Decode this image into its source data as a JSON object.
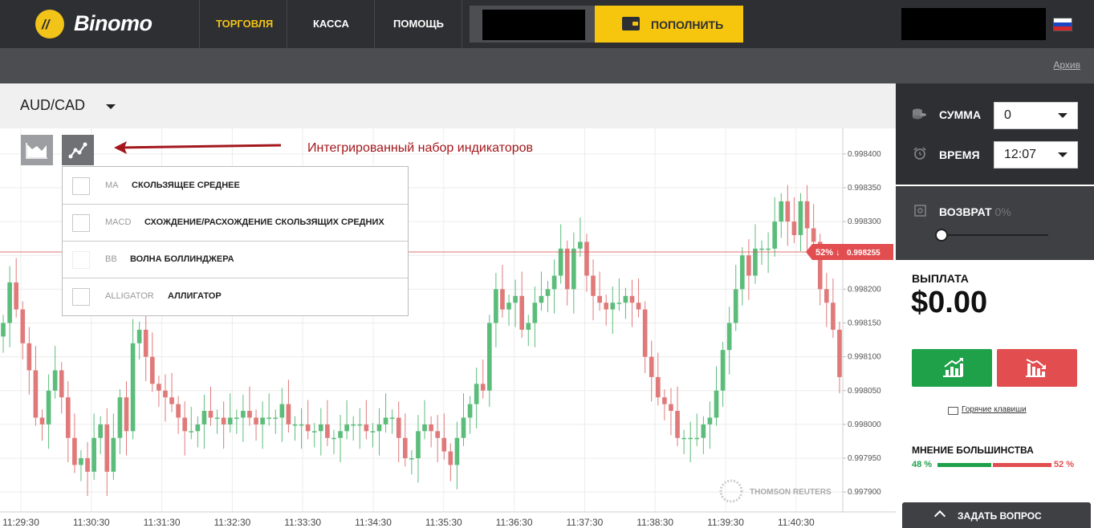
{
  "header": {
    "brand": "Binomo",
    "nav": [
      {
        "label": "ТОРГОВЛЯ",
        "active": true
      },
      {
        "label": "КАССА",
        "active": false
      },
      {
        "label": "ПОМОЩЬ",
        "active": false
      }
    ],
    "deposit_label": "ПОПОЛНИТЬ",
    "deposit_color": "#f6c50e",
    "active_nav_color": "#f2c319",
    "flag_icon": "russia-flag-icon"
  },
  "subbar": {
    "archive_link": "Архив"
  },
  "asset": {
    "name": "AUD/CAD"
  },
  "toolbar": {
    "chart_type_icon": "area-chart-icon",
    "indicators_icon": "indicators-icon"
  },
  "annotation": {
    "text": "Интегрированный набор индикаторов",
    "color": "#a3171c"
  },
  "indicators": [
    {
      "code": "MA",
      "name": "СКОЛЬЗЯЩЕЕ СРЕДНЕЕ"
    },
    {
      "code": "MACD",
      "name": "СХОЖДЕНИЕ/РАСХОЖДЕНИЕ СКОЛЬЗЯЩИХ СРЕДНИХ"
    },
    {
      "code": "BB",
      "name": "ВОЛНА БОЛЛИНДЖЕРА"
    },
    {
      "code": "ALLIGATOR",
      "name": "АЛЛИГАТОР"
    }
  ],
  "chart_data": {
    "type": "candlestick",
    "y_ticks": [
      "0.998400",
      "0.998350",
      "0.998300",
      "0.998250",
      "0.998200",
      "0.998150",
      "0.998100",
      "0.998050",
      "0.998000",
      "0.997950",
      "0.997900"
    ],
    "ylim": [
      0.99788,
      0.99842
    ],
    "x_ticks": [
      "11:29:30",
      "11:30:30",
      "11:31:30",
      "11:32:30",
      "11:33:30",
      "11:34:30",
      "11:35:30",
      "11:36:30",
      "11:37:30",
      "11:38:30",
      "11:39:30",
      "11:40:30"
    ],
    "current_price": "0.998255",
    "current_price_value": 0.998255,
    "current_badge_pct": "52%",
    "watermark": "THOMSON REUTERS",
    "up_color": "#5cbd7b",
    "down_color": "#e07a7a",
    "closes": [
      0.99815,
      0.99821,
      0.99817,
      0.99812,
      0.99808,
      0.99801,
      0.998,
      0.99805,
      0.99808,
      0.99804,
      0.99798,
      0.99794,
      0.99795,
      0.99793,
      0.99798,
      0.998,
      0.99793,
      0.99798,
      0.99804,
      0.99799,
      0.99812,
      0.99814,
      0.9981,
      0.99806,
      0.99805,
      0.99804,
      0.99803,
      0.99801,
      0.99799,
      0.99799,
      0.998,
      0.99802,
      0.99801,
      0.99801,
      0.998,
      0.99801,
      0.99801,
      0.99802,
      0.99801,
      0.998,
      0.99801,
      0.99801,
      0.99801,
      0.99803,
      0.998,
      0.998,
      0.998,
      0.99799,
      0.99799,
      0.998,
      0.99798,
      0.99798,
      0.99799,
      0.998,
      0.998,
      0.998,
      0.99799,
      0.99799,
      0.998,
      0.99801,
      0.99801,
      0.99798,
      0.99795,
      0.99795,
      0.99799,
      0.998,
      0.99799,
      0.99798,
      0.99796,
      0.99794,
      0.99798,
      0.99801,
      0.99803,
      0.99806,
      0.99805,
      0.99815,
      0.9982,
      0.99817,
      0.99818,
      0.99819,
      0.99814,
      0.99815,
      0.99818,
      0.99819,
      0.9982,
      0.99822,
      0.99826,
      0.9982,
      0.99826,
      0.99827,
      0.99822,
      0.99819,
      0.99818,
      0.99817,
      0.99818,
      0.99818,
      0.99819,
      0.99818,
      0.99817,
      0.9981,
      0.99807,
      0.99804,
      0.99803,
      0.99802,
      0.99798,
      0.99798,
      0.99798,
      0.99798,
      0.998,
      0.99801,
      0.99805,
      0.99811,
      0.99815,
      0.9982,
      0.99825,
      0.99822,
      0.99826,
      0.99826,
      0.99826,
      0.9983,
      0.99833,
      0.9983,
      0.99828,
      0.99833,
      0.99829,
      0.99827,
      0.9982,
      0.99818,
      0.99814,
      0.99807
    ]
  },
  "panel": {
    "amount_label": "СУММА",
    "amount_value": "0",
    "time_label": "ВРЕМЯ",
    "time_value": "12:07",
    "return_label": "ВОЗВРАТ",
    "return_value": "0%",
    "return_slider_fraction": 0,
    "payout_label": "ВЫПЛАТА",
    "payout_value": "$0.00",
    "up_color": "#1fa14a",
    "down_color": "#e24d4f",
    "hotkeys_label": "Горячие клавиши",
    "majority_label": "МНЕНИЕ БОЛЬШИНСТВА",
    "majority_up": "48 %",
    "majority_down": "52 %",
    "majority_up_fraction": 0.48,
    "ask_label": "ЗАДАТЬ ВОПРОС"
  }
}
